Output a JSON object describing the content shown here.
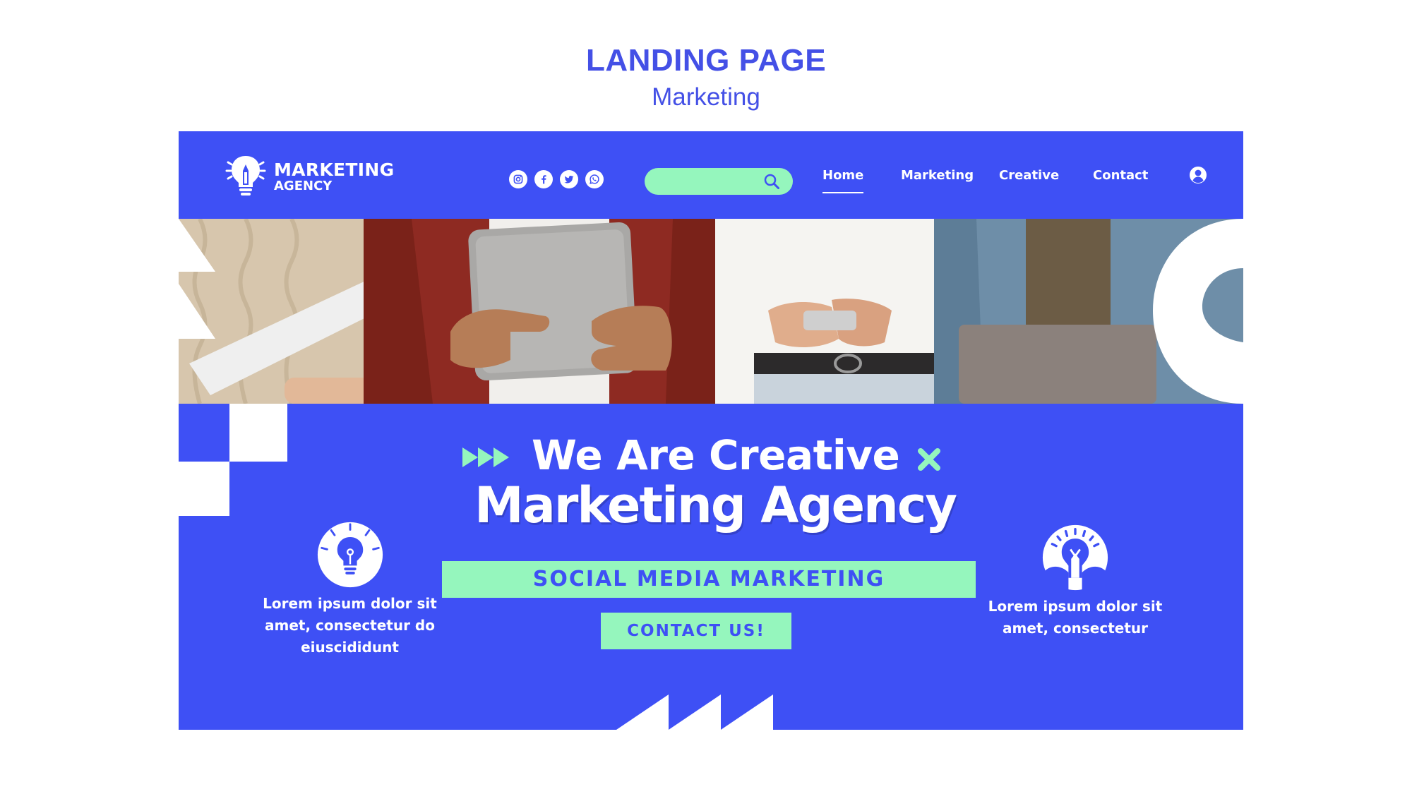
{
  "page": {
    "title": "LANDING PAGE",
    "subtitle": "Marketing"
  },
  "colors": {
    "brand_blue": "#3e50f5",
    "mint": "#95f6bd",
    "white": "#ffffff",
    "title_blue": "#4450e6"
  },
  "navbar": {
    "logo_line1": "MARKETING",
    "logo_line2": "AGENCY",
    "logo_icon": "lightbulb-pencil-icon",
    "social": [
      {
        "icon": "instagram-icon"
      },
      {
        "icon": "facebook-icon"
      },
      {
        "icon": "twitter-icon"
      },
      {
        "icon": "whatsapp-icon"
      }
    ],
    "search": {
      "placeholder": "",
      "icon": "search-icon"
    },
    "links": [
      {
        "label": "Home",
        "active": true
      },
      {
        "label": "Marketing",
        "active": false
      },
      {
        "label": "Creative",
        "active": false
      },
      {
        "label": "Contact",
        "active": false
      }
    ],
    "user_icon": "user-icon"
  },
  "hero": {
    "headline_line1": "We Are Creative",
    "headline_line2": "Marketing Agency",
    "banner": "SOCIAL MEDIA MARKETING",
    "cta": "CONTACT US!",
    "left_feature": {
      "icon": "lightbulb-icon",
      "text": "Lorem ipsum dolor sit amet, consectetur do eiuscididunt"
    },
    "right_feature": {
      "icon": "lightbulb-pencil-icon",
      "text": "Lorem ipsum dolor sit amet, consectetur"
    }
  }
}
